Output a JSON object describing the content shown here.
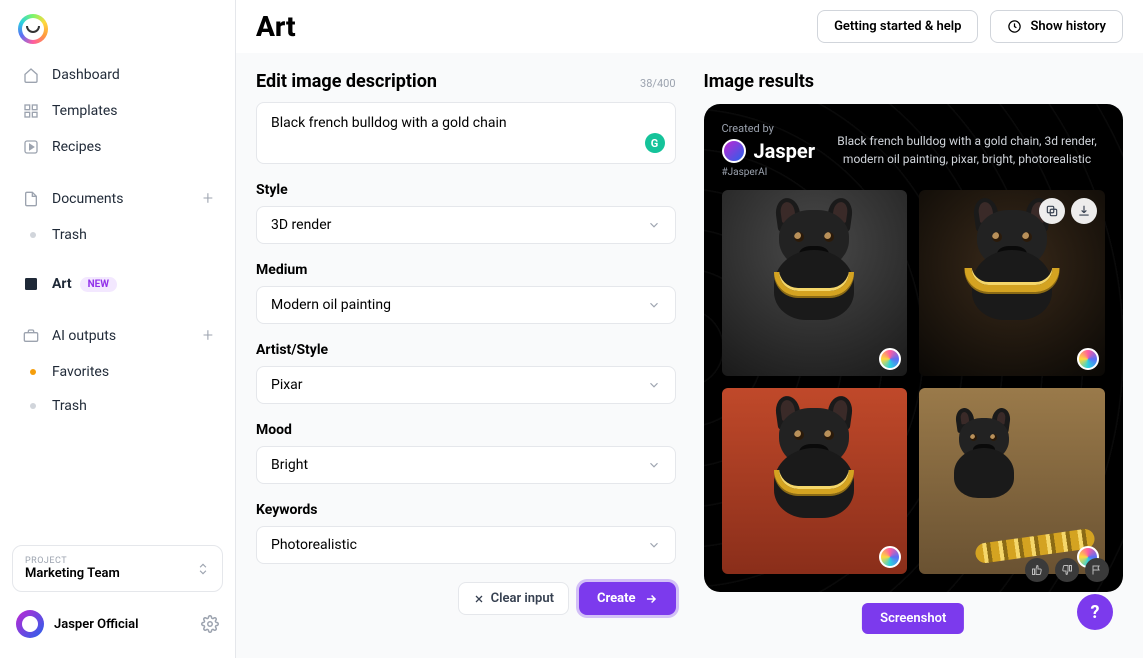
{
  "header": {
    "title": "Art",
    "getting_started": "Getting started & help",
    "show_history": "Show history"
  },
  "sidebar": {
    "items": [
      {
        "label": "Dashboard"
      },
      {
        "label": "Templates"
      },
      {
        "label": "Recipes"
      },
      {
        "label": "Documents"
      },
      {
        "label": "Trash"
      },
      {
        "label": "Art",
        "badge": "NEW"
      },
      {
        "label": "AI outputs"
      },
      {
        "label": "Favorites"
      },
      {
        "label": "Trash"
      }
    ],
    "project_label": "PROJECT",
    "project_name": "Marketing Team",
    "user_name": "Jasper Official"
  },
  "form": {
    "edit_title": "Edit image description",
    "char_count": "38/400",
    "description": "Black french bulldog with a gold chain",
    "fields": {
      "style": {
        "label": "Style",
        "value": "3D render"
      },
      "medium": {
        "label": "Medium",
        "value": "Modern oil painting"
      },
      "artist": {
        "label": "Artist/Style",
        "value": "Pixar"
      },
      "mood": {
        "label": "Mood",
        "value": "Bright"
      },
      "keywords": {
        "label": "Keywords",
        "value": "Photorealistic"
      }
    },
    "clear": "Clear input",
    "create": "Create"
  },
  "results": {
    "title": "Image results",
    "created_by_label": "Created by",
    "creator": "Jasper",
    "tag": "#JasperAI",
    "prompt": "Black french bulldog with a gold chain, 3d render, modern oil painting, pixar, bright, photorealistic",
    "screenshot": "Screenshot"
  }
}
